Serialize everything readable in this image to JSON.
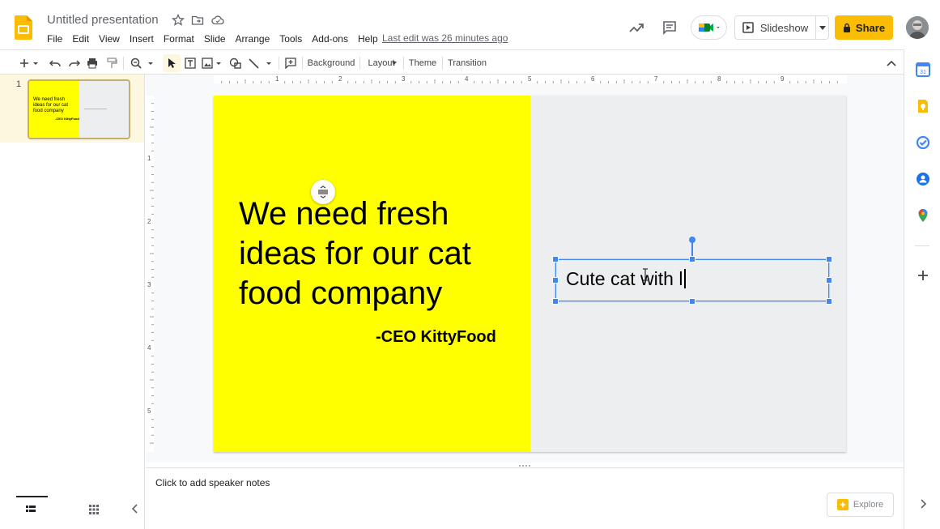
{
  "app": {
    "title": "Untitled presentation",
    "last_edit": "Last edit was 26 minutes ago"
  },
  "menu": [
    "File",
    "Edit",
    "View",
    "Insert",
    "Format",
    "Slide",
    "Arrange",
    "Tools",
    "Add-ons",
    "Help"
  ],
  "header": {
    "slideshow_label": "Slideshow",
    "share_label": "Share"
  },
  "toolbar": {
    "background_label": "Background",
    "layout_label": "Layout",
    "theme_label": "Theme",
    "transition_label": "Transition"
  },
  "filmstrip": {
    "slide_number": "1",
    "thumb_text": "We need fresh ideas for our cat food company",
    "thumb_ceo": "-CEO KittyFood"
  },
  "ruler": {
    "top_ticks": [
      "1",
      "2",
      "3",
      "4",
      "5",
      "6",
      "7",
      "8",
      "9"
    ],
    "left_ticks": [
      "1",
      "2",
      "3",
      "4",
      "5"
    ]
  },
  "slide": {
    "headline": "We need fresh ideas for our cat food company",
    "attribution": "-CEO KittyFood",
    "textbox_value": "Cute cat with l"
  },
  "notes": {
    "placeholder": "Click to add speaker notes"
  },
  "explore_label": "Explore",
  "colors": {
    "accent_yellow": "#ffff00",
    "share_yellow": "#fbbc04",
    "selection_blue": "#4285f4"
  }
}
